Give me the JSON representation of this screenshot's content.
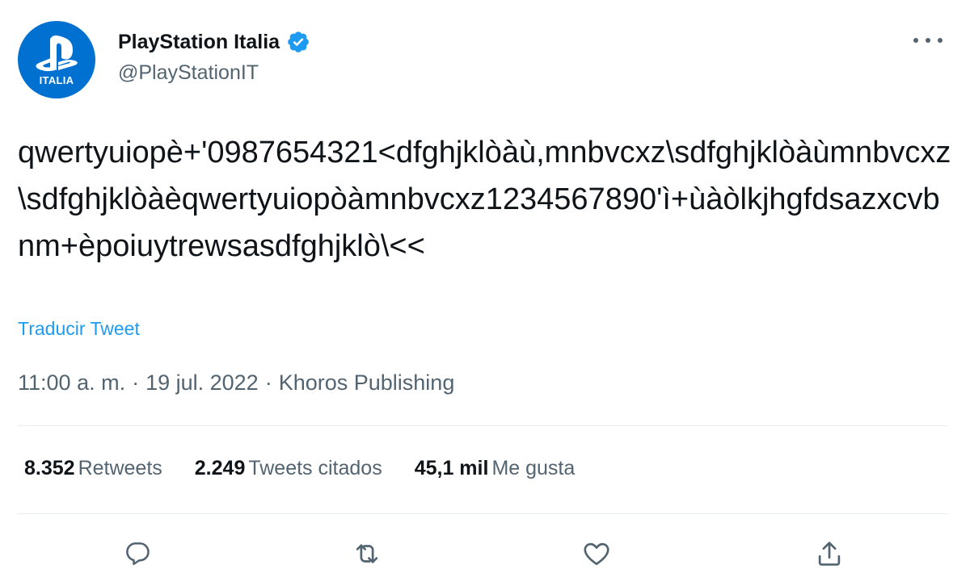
{
  "author": {
    "name": "PlayStation Italia",
    "handle": "@PlayStationIT",
    "avatar_label": "ITALIA",
    "verified": true,
    "brand_color": "#0070d1",
    "verified_color": "#1d9bf0"
  },
  "tweet": {
    "text": "qwertyuiopè+'0987654321<dfghjklòàù,mnbvcxz\\sdfghjklòàùmnbvcxz\\sdfghjklòàèqwertyuiopòàmnbvcxz1234567890'ì+ùàòlkjhgfdsazxcvbnm+èpoiuytrewsasdfghjklò\\<<",
    "translate_label": "Traducir Tweet",
    "time": "11:00 a. m.",
    "date": "19 jul. 2022",
    "source": "Khoros Publishing",
    "separator": "·"
  },
  "stats": {
    "retweets_count": "8.352",
    "retweets_label": "Retweets",
    "quotes_count": "2.249",
    "quotes_label": "Tweets citados",
    "likes_count": "45,1 mil",
    "likes_label": "Me gusta"
  },
  "icons": {
    "more": "more-icon",
    "reply": "reply-icon",
    "retweet": "retweet-icon",
    "like": "like-icon",
    "share": "share-icon",
    "logo": "playstation-logo-icon",
    "verified": "verified-badge-icon"
  },
  "colors": {
    "text": "#0f1419",
    "secondary": "#536471",
    "link": "#1d9bf0",
    "divider": "#e6ecf0"
  }
}
